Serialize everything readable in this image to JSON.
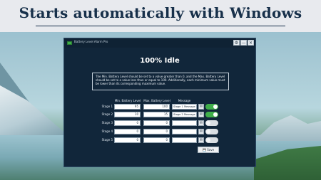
{
  "banner": {
    "title": "Starts automatically with Windows"
  },
  "window": {
    "title": "Battery Level Alarm Pro",
    "controls": {
      "settings_icon": "gear-icon",
      "minimize": "—",
      "close": "✕"
    }
  },
  "main": {
    "heading": "100% Idle",
    "info": "The Min. Battery Level should be set to a value greater than 0, and the Max. Battery Level should be set to a value less than or equal to 100. Additionally, each minimum value must be lower than its corresponding maximum value.",
    "columns": {
      "min": "Min. Battery Level",
      "max": "Max. Battery Level",
      "message": "Message"
    },
    "stages": [
      {
        "label": "Stage 1",
        "min": "95",
        "max": "100",
        "message": "Stage 1 Message",
        "enabled": true
      },
      {
        "label": "Stage 2",
        "min": "10",
        "max": "15",
        "message": "Stage 2 Message",
        "enabled": true
      },
      {
        "label": "Stage 3",
        "min": "0",
        "max": "0",
        "message": "",
        "enabled": false
      },
      {
        "label": "Stage 4",
        "min": "0",
        "max": "0",
        "message": "",
        "enabled": false
      },
      {
        "label": "Stage 5",
        "min": "0",
        "max": "0",
        "message": "",
        "enabled": false
      }
    ],
    "save_label": "Save",
    "save_icon": "floppy-disk-icon",
    "message_button_icon": "message-icon"
  },
  "colors": {
    "accent_green": "#3fae49",
    "window_bg": "#11263a",
    "banner_text": "#17304a"
  }
}
